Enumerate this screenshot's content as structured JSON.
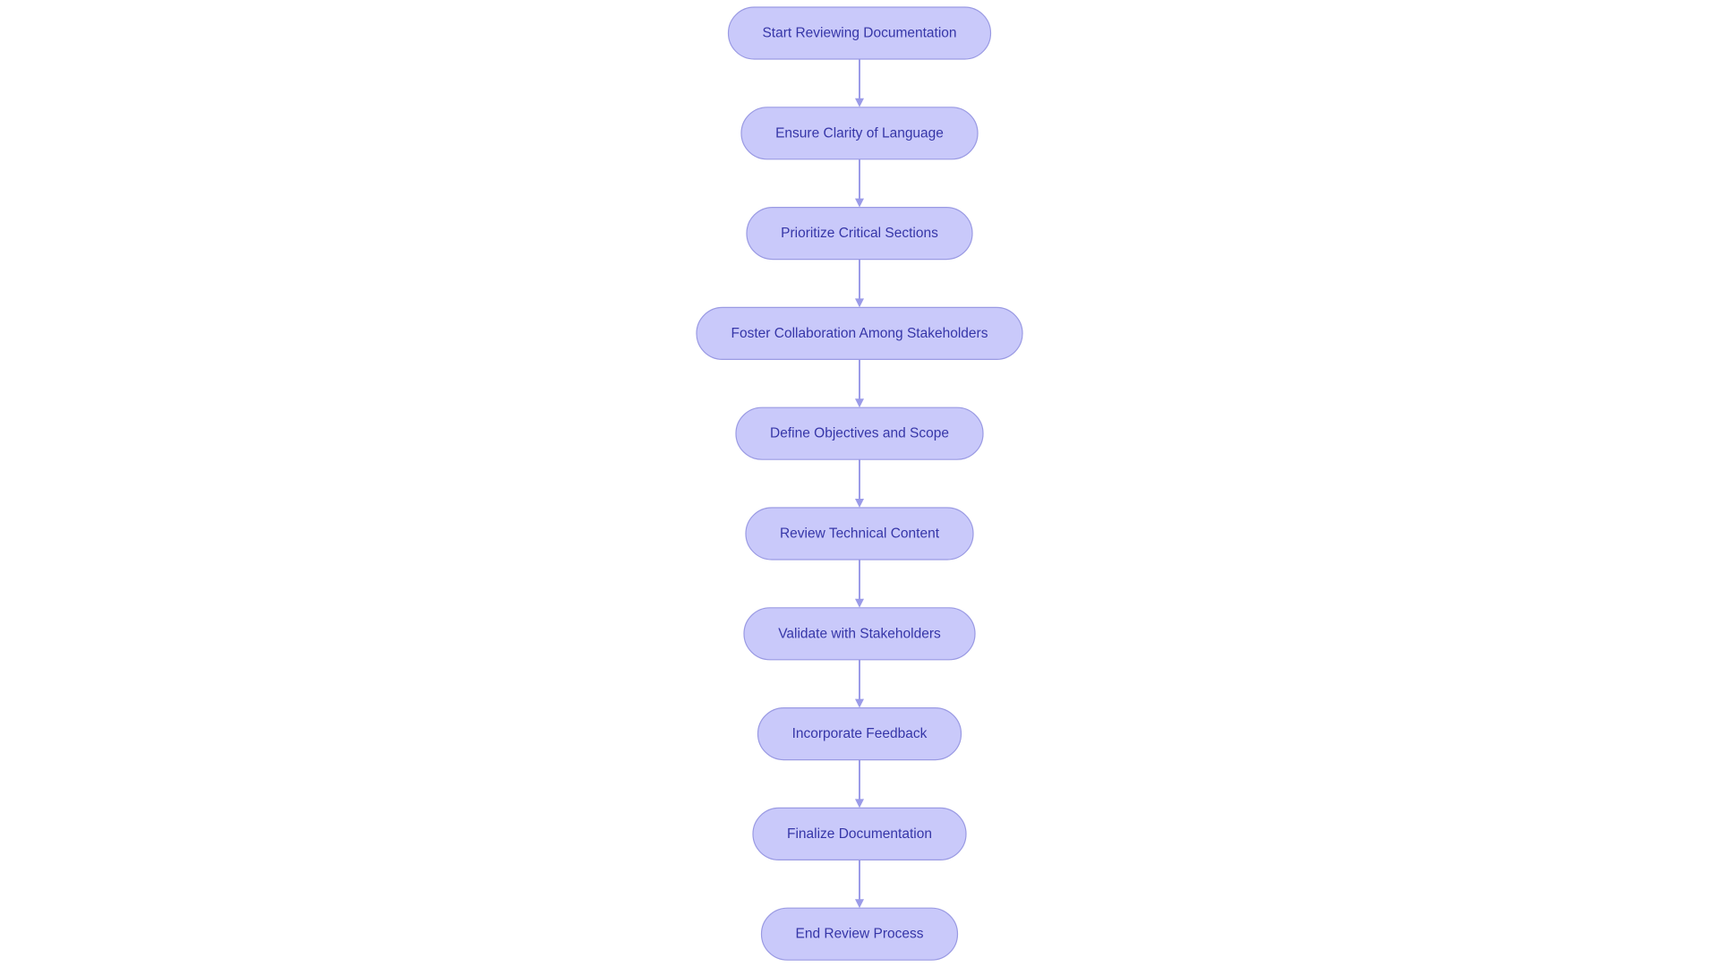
{
  "diagram": {
    "type": "flowchart",
    "direction": "top-to-bottom",
    "colors": {
      "node_fill": "#c9c9fa",
      "node_stroke": "#9a9ae3",
      "node_text": "#3636a8",
      "edge": "#9b9be8",
      "background": "#ffffff"
    },
    "nodes": [
      {
        "id": "n1",
        "label": "Start Reviewing Documentation",
        "shape": "stadium"
      },
      {
        "id": "n2",
        "label": "Ensure Clarity of Language",
        "shape": "stadium"
      },
      {
        "id": "n3",
        "label": "Prioritize Critical Sections",
        "shape": "stadium"
      },
      {
        "id": "n4",
        "label": "Foster Collaboration Among Stakeholders",
        "shape": "stadium"
      },
      {
        "id": "n5",
        "label": "Define Objectives and Scope",
        "shape": "stadium"
      },
      {
        "id": "n6",
        "label": "Review Technical Content",
        "shape": "stadium"
      },
      {
        "id": "n7",
        "label": "Validate with Stakeholders",
        "shape": "stadium"
      },
      {
        "id": "n8",
        "label": "Incorporate Feedback",
        "shape": "stadium"
      },
      {
        "id": "n9",
        "label": "Finalize Documentation",
        "shape": "stadium"
      },
      {
        "id": "n10",
        "label": "End Review Process",
        "shape": "stadium"
      }
    ],
    "edges": [
      {
        "from": "n1",
        "to": "n2"
      },
      {
        "from": "n2",
        "to": "n3"
      },
      {
        "from": "n3",
        "to": "n4"
      },
      {
        "from": "n4",
        "to": "n5"
      },
      {
        "from": "n5",
        "to": "n6"
      },
      {
        "from": "n6",
        "to": "n7"
      },
      {
        "from": "n7",
        "to": "n8"
      },
      {
        "from": "n8",
        "to": "n9"
      },
      {
        "from": "n9",
        "to": "n10"
      }
    ]
  }
}
